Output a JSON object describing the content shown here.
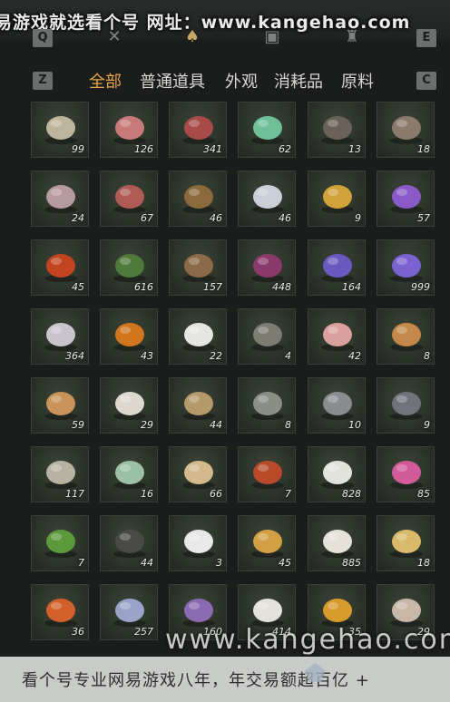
{
  "watermark_top": "易游戏就选看个号  网址：www.kangehao.com",
  "watermark_bottom": "看个号专业网易游戏八年，年交易额超百亿 +",
  "watermark_mid": "www.kangehao.com",
  "tabs": {
    "left_key": "Q",
    "right_key": "E",
    "icons": [
      "sword-icon",
      "gourd-icon",
      "chest-icon",
      "armor-icon"
    ],
    "active_index": 1
  },
  "filter": {
    "left_key": "Z",
    "right_key": "C",
    "categories": [
      "全部",
      "普通道具",
      "外观",
      "消耗品",
      "原料"
    ],
    "selected_index": 0
  },
  "items": [
    {
      "name": "bird-eggs-item",
      "count": "99",
      "color": "#bdb49c"
    },
    {
      "name": "raw-meat-item",
      "count": "126",
      "color": "#c97a78"
    },
    {
      "name": "steak-item",
      "count": "341",
      "color": "#a84a48"
    },
    {
      "name": "jade-stone-item",
      "count": "62",
      "color": "#6fbf9a"
    },
    {
      "name": "feathers-item",
      "count": "13",
      "color": "#6a6158"
    },
    {
      "name": "fur-pelt-item",
      "count": "18",
      "color": "#8a7a6a"
    },
    {
      "name": "intestines-item",
      "count": "24",
      "color": "#b79aa0"
    },
    {
      "name": "meat-slab-item",
      "count": "67",
      "color": "#b05a56"
    },
    {
      "name": "catfish-item",
      "count": "46",
      "color": "#8a6a3a"
    },
    {
      "name": "silver-fish-item",
      "count": "46",
      "color": "#c8cfd6"
    },
    {
      "name": "golden-carp-item",
      "count": "9",
      "color": "#d1a23a"
    },
    {
      "name": "amethyst-item",
      "count": "57",
      "color": "#8a5ac8"
    },
    {
      "name": "red-agate-item",
      "count": "45",
      "color": "#c0441e"
    },
    {
      "name": "herb-plant-item",
      "count": "616",
      "color": "#4f7a3a"
    },
    {
      "name": "mortar-herbs-item",
      "count": "157",
      "color": "#8a6a48"
    },
    {
      "name": "purple-flower-item",
      "count": "448",
      "color": "#8a3a6a"
    },
    {
      "name": "lavender-item",
      "count": "164",
      "color": "#6a5ac0"
    },
    {
      "name": "lavender-bunch-item",
      "count": "999",
      "color": "#7a62d0"
    },
    {
      "name": "white-blossom-item",
      "count": "364",
      "color": "#c9c3cc"
    },
    {
      "name": "orange-flower-item",
      "count": "43",
      "color": "#d2761e"
    },
    {
      "name": "white-feather-item",
      "count": "22",
      "color": "#e4e4e0"
    },
    {
      "name": "dark-feather-item",
      "count": "4",
      "color": "#7c7c72"
    },
    {
      "name": "fish-fillet-item",
      "count": "42",
      "color": "#d9a09c"
    },
    {
      "name": "soup-bowl-item",
      "count": "8",
      "color": "#c4884a"
    },
    {
      "name": "fried-dough-item",
      "count": "59",
      "color": "#c9935a"
    },
    {
      "name": "white-coral-item",
      "count": "29",
      "color": "#dcd8d0"
    },
    {
      "name": "pufferfish-item",
      "count": "44",
      "color": "#b49a6a"
    },
    {
      "name": "grey-fish-item",
      "count": "8",
      "color": "#8a8e86"
    },
    {
      "name": "iron-ore-item",
      "count": "10",
      "color": "#8a8c90"
    },
    {
      "name": "dark-ore-item",
      "count": "9",
      "color": "#70747a"
    },
    {
      "name": "fish-bones-item",
      "count": "117",
      "color": "#b8b2a2"
    },
    {
      "name": "green-melon-item",
      "count": "16",
      "color": "#9cc0a4"
    },
    {
      "name": "rice-bundle-item",
      "count": "66",
      "color": "#d2b88a"
    },
    {
      "name": "red-berries-item",
      "count": "7",
      "color": "#b84a2a"
    },
    {
      "name": "white-flowers-item",
      "count": "828",
      "color": "#e2e2dc"
    },
    {
      "name": "pink-flowers-item",
      "count": "85",
      "color": "#d25a9a"
    },
    {
      "name": "green-sprout-item",
      "count": "7",
      "color": "#5a9a3a"
    },
    {
      "name": "black-plume-item",
      "count": "44",
      "color": "#4a4a48"
    },
    {
      "name": "black-white-tuft-item",
      "count": "3",
      "color": "#e8e8e8"
    },
    {
      "name": "gold-nugget-item",
      "count": "45",
      "color": "#d2a042"
    },
    {
      "name": "rice-bowl-item",
      "count": "885",
      "color": "#e6e2da"
    },
    {
      "name": "mixed-nuts-item",
      "count": "18",
      "color": "#d8ba6a"
    },
    {
      "name": "orange-stone-item",
      "count": "36",
      "color": "#d2602a"
    },
    {
      "name": "blue-thistle-item",
      "count": "257",
      "color": "#9aa4c8"
    },
    {
      "name": "purple-spike-item",
      "count": "160",
      "color": "#8a6ab0"
    },
    {
      "name": "white-rose-item",
      "count": "414",
      "color": "#e4e0da"
    },
    {
      "name": "citrus-branch-item",
      "count": "35",
      "color": "#d89a2a"
    },
    {
      "name": "ginseng-root-item",
      "count": "29",
      "color": "#c8b8a8"
    }
  ]
}
